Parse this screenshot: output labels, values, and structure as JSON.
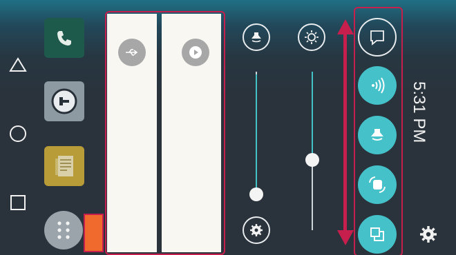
{
  "status_bar": {
    "time": "5:31 PM"
  },
  "navigation": {
    "buttons": [
      {
        "name": "back",
        "icon": "triangle-icon"
      },
      {
        "name": "home",
        "icon": "circle-icon"
      },
      {
        "name": "recents",
        "icon": "square-icon"
      }
    ]
  },
  "home_apps": [
    {
      "name": "phone",
      "icon": "phone-icon",
      "color": "#1e5a4c"
    },
    {
      "name": "entertainment",
      "icon": "speaker-icon",
      "color": "#8e9aa1"
    },
    {
      "name": "notes",
      "icon": "notes-icon",
      "color": "#b89c38"
    },
    {
      "name": "app-drawer",
      "icon": "grid-dots-icon",
      "color": "#9aa4aa"
    }
  ],
  "notification_panels": [
    {
      "name": "usb",
      "icon": "usb-icon"
    },
    {
      "name": "media",
      "icon": "play-icon"
    }
  ],
  "sliders": [
    {
      "name": "ring-volume",
      "icon": "bell-icon",
      "level": 0.2
    },
    {
      "name": "brightness",
      "icon": "brightness-icon",
      "level": 0.6
    }
  ],
  "quick_settings": [
    {
      "name": "edit",
      "icon": "edit-icon",
      "style": "outline"
    },
    {
      "name": "nfc",
      "icon": "nfc-icon",
      "style": "teal"
    },
    {
      "name": "sound",
      "icon": "bell-icon",
      "style": "teal"
    },
    {
      "name": "rotate",
      "icon": "rotate-icon",
      "style": "teal"
    },
    {
      "name": "multi-window",
      "icon": "multiwindow-icon",
      "style": "teal"
    }
  ],
  "colors": {
    "accent": "#44c1c9",
    "highlight": "#c61f4d",
    "orange": "#ef6a2c"
  }
}
